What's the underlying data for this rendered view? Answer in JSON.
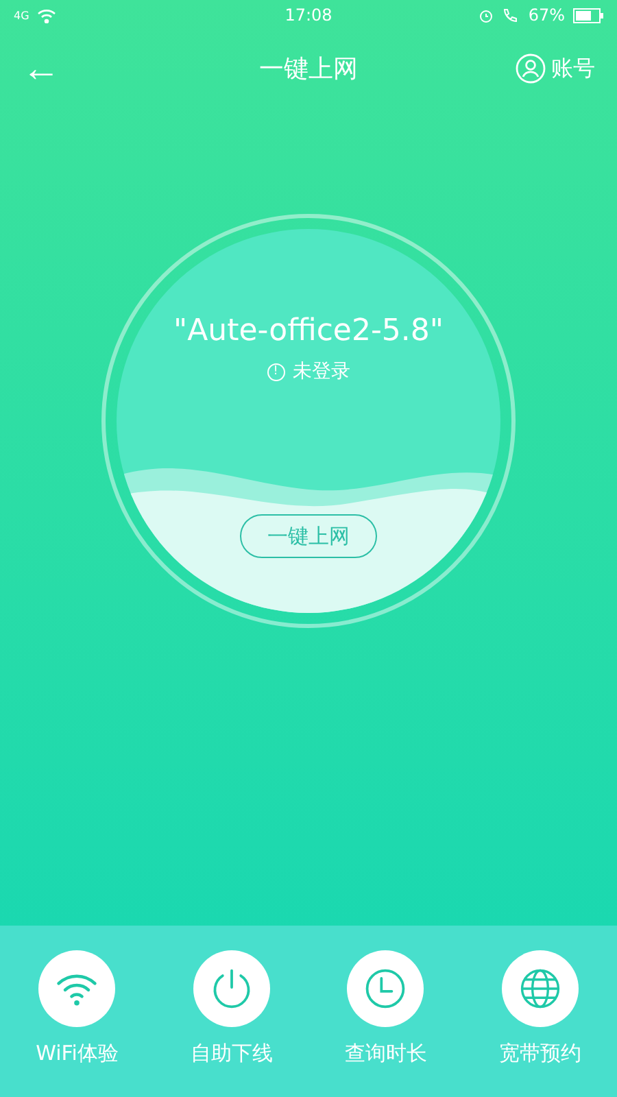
{
  "status_bar": {
    "signal": "4G",
    "time": "17:08",
    "battery": "67%"
  },
  "header": {
    "back": "←",
    "title": "一键上网",
    "account": "账号"
  },
  "network": {
    "ssid": "\"Aute-office2-5.8\"",
    "status_icon": "!",
    "status": "未登录",
    "button": "一键上网"
  },
  "actions": [
    {
      "kind": "wifi",
      "label": "WiFi体验"
    },
    {
      "kind": "power",
      "label": "自助下线"
    },
    {
      "kind": "clock",
      "label": "查询时长"
    },
    {
      "kind": "globe",
      "label": "宽带预约"
    }
  ]
}
